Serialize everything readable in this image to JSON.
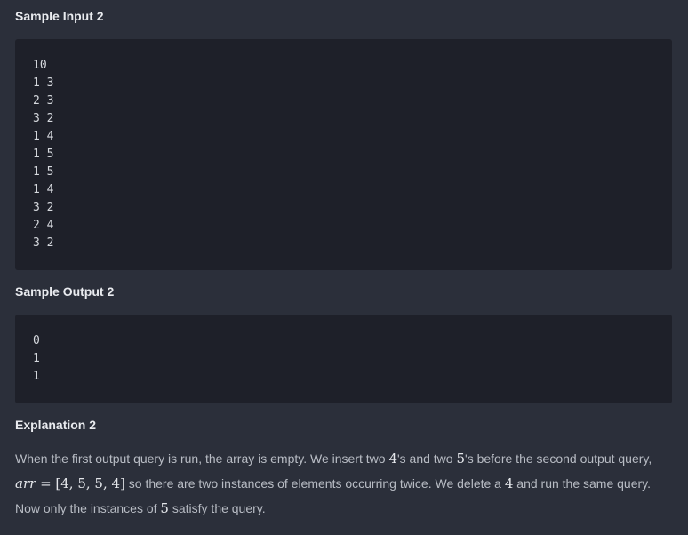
{
  "sample_input": {
    "heading": "Sample Input 2",
    "lines": [
      "10",
      "1 3",
      "2 3",
      "3 2",
      "1 4",
      "1 5",
      "1 5",
      "1 4",
      "3 2",
      "2 4",
      "3 2"
    ]
  },
  "sample_output": {
    "heading": "Sample Output 2",
    "lines": [
      "0",
      "1",
      "1"
    ]
  },
  "explanation": {
    "heading": "Explanation 2",
    "text_1": "When the first output query is run, the array is empty. We insert two ",
    "math_1": "4",
    "text_2": "'s and two ",
    "math_2": "5",
    "text_3": "'s before the second output query, ",
    "math_3_var": "arr",
    "math_3_rest": " = [4, 5, 5, 4]",
    "text_4": " so there are two instances of elements occurring twice. We delete a ",
    "math_4": "4",
    "text_5": " and run the same query. Now only the instances of ",
    "math_5": "5",
    "text_6": " satisfy the query."
  }
}
